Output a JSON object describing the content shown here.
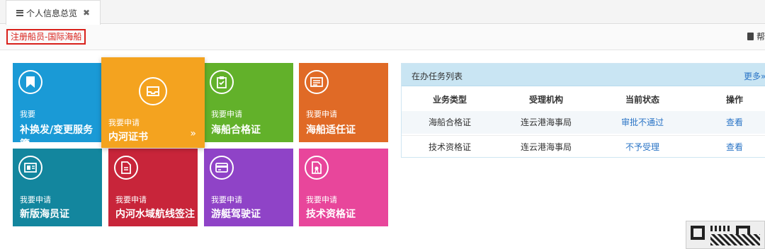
{
  "tabs": [
    {
      "label": "个人信息总览",
      "close": "✖"
    }
  ],
  "breadcrumb": "注册船员-国际海船",
  "help_label": "帮",
  "tiles": [
    {
      "small": "我要",
      "big": "补换发/变更服务簿",
      "color": "#1a9ad6",
      "icon": "bookmark-icon"
    },
    {
      "small": "我要申请",
      "big": "内河证书",
      "color": "#f4a31f",
      "icon": "inbox-icon",
      "chevron": "»"
    },
    {
      "small": "我要申请",
      "big": "海船合格证",
      "color": "#62b12a",
      "icon": "clipboard-check-icon"
    },
    {
      "small": "我要申请",
      "big": "海船适任证",
      "color": "#e06a26",
      "icon": "list-card-icon"
    },
    {
      "small": "我要申请",
      "big": "新版海员证",
      "color": "#13869e",
      "icon": "id-card-icon"
    },
    {
      "small": "我要申请",
      "big": "内河水域航线签注",
      "color": "#c8253a",
      "icon": "document-icon"
    },
    {
      "small": "我要申请",
      "big": "游艇驾驶证",
      "color": "#8f43c7",
      "icon": "credit-card-icon"
    },
    {
      "small": "我要申请",
      "big": "技术资格证",
      "color": "#e8469b",
      "icon": "certificate-icon"
    }
  ],
  "task_panel": {
    "title": "在办任务列表",
    "more": "更多»",
    "columns": [
      "业务类型",
      "受理机构",
      "当前状态",
      "操作"
    ],
    "rows": [
      {
        "type": "海船合格证",
        "org": "连云港海事局",
        "status": "审批不通过",
        "action": "查看"
      },
      {
        "type": "技术资格证",
        "org": "连云港海事局",
        "status": "不予受理",
        "action": "查看"
      }
    ]
  }
}
